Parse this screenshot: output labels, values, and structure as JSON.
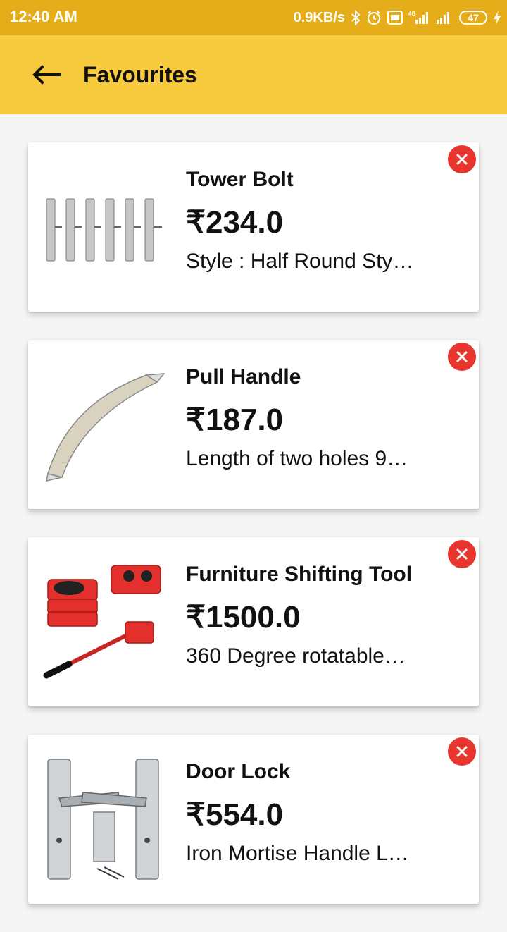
{
  "status_bar": {
    "time": "12:40 AM",
    "speed": "0.9KB/s",
    "network": "4G",
    "battery": "47"
  },
  "app_bar": {
    "title": "Favourites"
  },
  "items": [
    {
      "name": "Tower Bolt",
      "price": "₹234.0",
      "description": "Style : Half Round Sty…"
    },
    {
      "name": "Pull Handle",
      "price": "₹187.0",
      "description": "Length of two holes 9…"
    },
    {
      "name": "Furniture Shifting Tool",
      "price": "₹1500.0",
      "description": "360 Degree rotatable…"
    },
    {
      "name": "Door Lock",
      "price": "₹554.0",
      "description": "Iron Mortise Handle L…"
    }
  ],
  "colors": {
    "status_bar": "#e5ad1a",
    "app_bar": "#f8cb3f",
    "remove": "#e8352e"
  }
}
